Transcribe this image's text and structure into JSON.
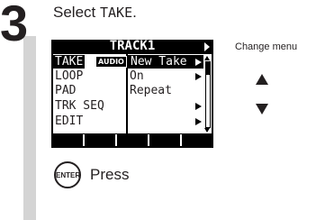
{
  "step": {
    "number": "3",
    "heading_prefix": "Select ",
    "heading_item": "TAKE",
    "heading_suffix": "."
  },
  "lcd": {
    "title": "TRACK1",
    "rows": [
      {
        "left": "TAKE",
        "badge": "AUDIO",
        "right": "New Take",
        "arrow": true,
        "selected": true
      },
      {
        "left": "LOOP",
        "badge": "",
        "right": "On",
        "arrow": true,
        "selected": false
      },
      {
        "left": "PAD",
        "badge": "",
        "right": "Repeat",
        "arrow": false,
        "selected": false
      },
      {
        "left": "TRK SEQ",
        "badge": "",
        "right": "",
        "arrow": true,
        "selected": false
      },
      {
        "left": "EDIT",
        "badge": "",
        "right": "",
        "arrow": true,
        "selected": false
      }
    ],
    "function_keys": 5
  },
  "side": {
    "change_label": "Change menu",
    "up_icon": "triangle-up-icon",
    "down_icon": "triangle-down-icon"
  },
  "action": {
    "button_text": "ENTER",
    "label": "Press"
  }
}
